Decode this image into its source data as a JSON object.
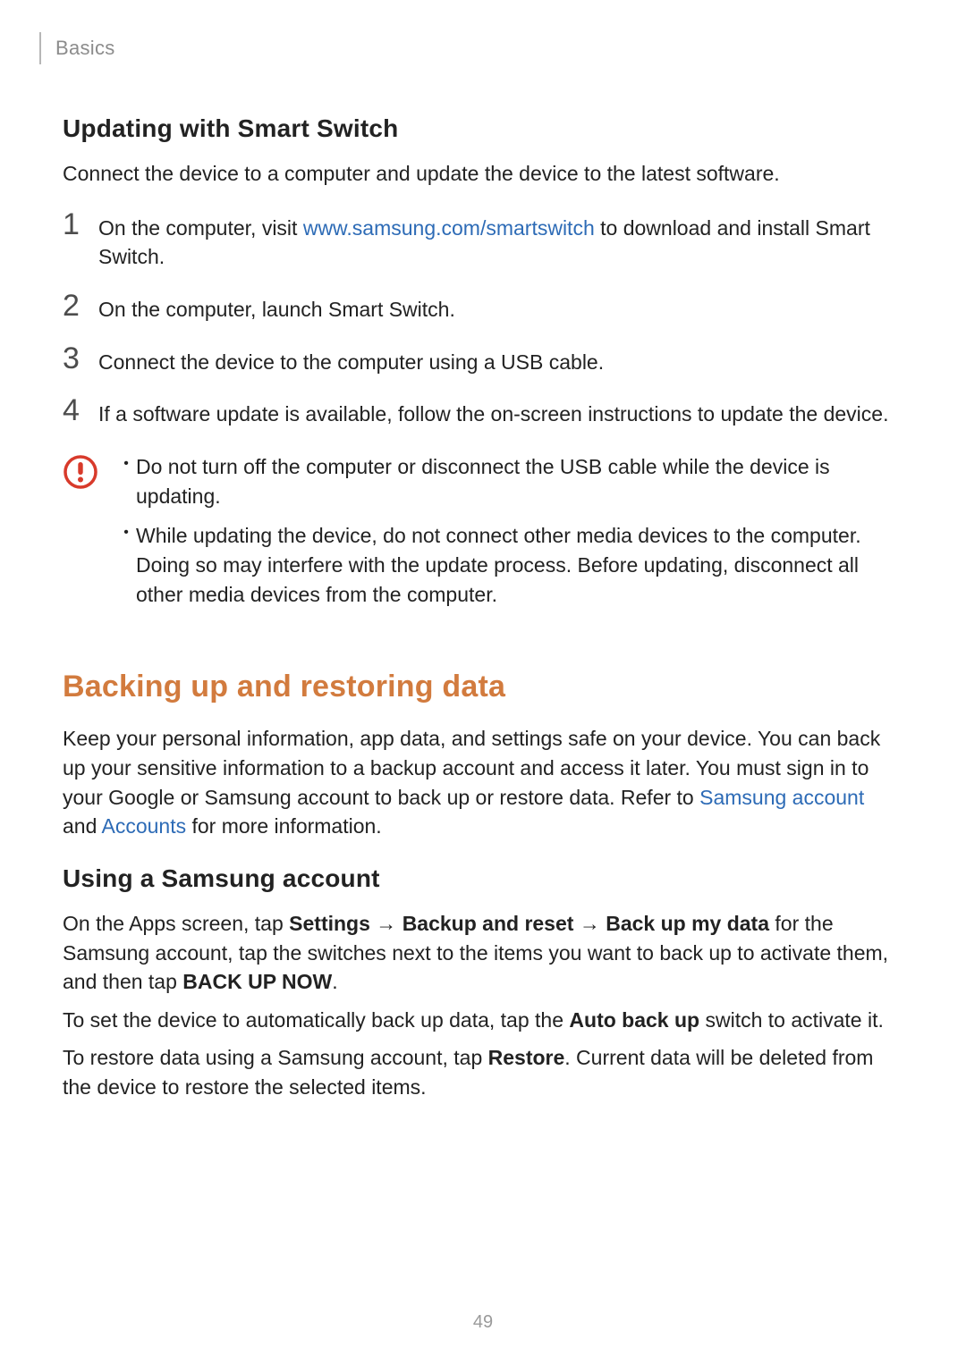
{
  "header": {
    "section": "Basics"
  },
  "heading1": "Updating with Smart Switch",
  "intro1": "Connect the device to a computer and update the device to the latest software.",
  "steps": [
    {
      "num": "1",
      "pre": "On the computer, visit ",
      "link": "www.samsung.com/smartswitch",
      "post": " to download and install Smart Switch."
    },
    {
      "num": "2",
      "text": "On the computer, launch Smart Switch."
    },
    {
      "num": "3",
      "text": "Connect the device to the computer using a USB cable."
    },
    {
      "num": "4",
      "text": "If a software update is available, follow the on-screen instructions to update the device."
    }
  ],
  "caution": {
    "items": [
      "Do not turn off the computer or disconnect the USB cable while the device is updating.",
      "While updating the device, do not connect other media devices to the computer. Doing so may interfere with the update process. Before updating, disconnect all other media devices from the computer."
    ]
  },
  "section2": {
    "title": "Backing up and restoring data",
    "para_pre": "Keep your personal information, app data, and settings safe on your device. You can back up your sensitive information to a backup account and access it later. You must sign in to your Google or Samsung account to back up or restore data. Refer to ",
    "link1": "Samsung account",
    "mid": " and ",
    "link2": "Accounts",
    "para_post": " for more information."
  },
  "heading2": "Using a Samsung account",
  "usage": {
    "p1_a": "On the Apps screen, tap ",
    "p1_b": "Settings",
    "arrow": " → ",
    "p1_c": "Backup and reset",
    "p1_d": "Back up my data",
    "p1_e": " for the Samsung account, tap the switches next to the items you want to back up to activate them, and then tap ",
    "p1_f": "BACK UP NOW",
    "p1_g": ".",
    "p2_a": "To set the device to automatically back up data, tap the ",
    "p2_b": "Auto back up",
    "p2_c": " switch to activate it.",
    "p3_a": "To restore data using a Samsung account, tap ",
    "p3_b": "Restore",
    "p3_c": ". Current data will be deleted from the device to restore the selected items."
  },
  "pageNumber": "49",
  "colors": {
    "accent": "#d27b3e",
    "link": "#2d6bb6"
  }
}
